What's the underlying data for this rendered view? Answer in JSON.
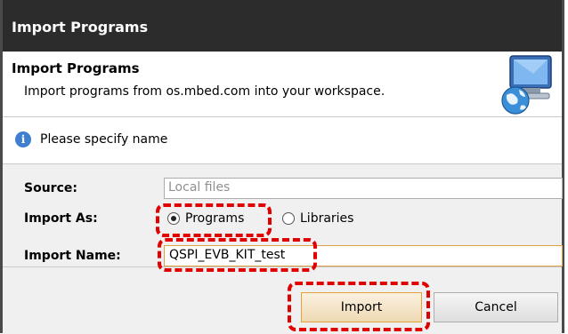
{
  "window": {
    "title": "Import Programs"
  },
  "header": {
    "title": "Import Programs",
    "description": "Import programs from os.mbed.com into your workspace.",
    "icon": "computer-globe-icon"
  },
  "info": {
    "icon": "info-icon",
    "message": "Please specify name"
  },
  "form": {
    "source_label": "Source:",
    "source_placeholder": "Local files",
    "import_as_label": "Import As:",
    "options": [
      {
        "label": "Programs",
        "selected": true
      },
      {
        "label": "Libraries",
        "selected": false
      }
    ],
    "import_name_label": "Import Name:",
    "import_name_value": "QSPI_EVB_KIT_test"
  },
  "buttons": {
    "import": "Import",
    "cancel": "Cancel"
  },
  "colors": {
    "highlight": "#e00000",
    "accent": "#e2a23c",
    "titlebar": "#2c2c2c"
  }
}
